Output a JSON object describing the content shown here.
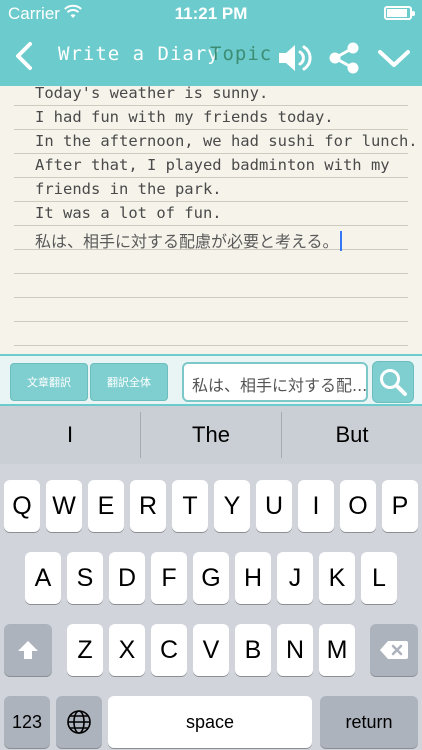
{
  "status_bar": {
    "carrier": "Carrier",
    "time": "11:21 PM"
  },
  "nav": {
    "title": "Write a Diary",
    "topic": "Topic",
    "icons": [
      "back-chevron-icon",
      "speaker-icon",
      "share-icon",
      "chevron-down-icon"
    ]
  },
  "diary": {
    "lines": [
      "Today's weather is sunny.",
      "I had fun with my friends today.",
      "In the afternoon, we had sushi for lunch.",
      "After that, I played badminton with my",
      "friends in the park.",
      "It was a lot of fun."
    ],
    "japanese_line": "私は、相手に対する配慮が必要と考える。"
  },
  "translate_bar": {
    "button_sentence": "文章翻訳",
    "button_all": "翻訳全体",
    "input_value": "私は、相手に対する配..."
  },
  "keyboard": {
    "suggestions": [
      "I",
      "The",
      "But"
    ],
    "row1": [
      "Q",
      "W",
      "E",
      "R",
      "T",
      "Y",
      "U",
      "I",
      "O",
      "P"
    ],
    "row2": [
      "A",
      "S",
      "D",
      "F",
      "G",
      "H",
      "J",
      "K",
      "L"
    ],
    "row3": [
      "Z",
      "X",
      "C",
      "V",
      "B",
      "N",
      "M"
    ],
    "numbers_key": "123",
    "space_key": "space",
    "return_key": "return"
  },
  "colors": {
    "accent": "#6ccbcc",
    "topic": "#3d8d75",
    "paper": "#f6f3ea",
    "caret": "#3478f6"
  }
}
